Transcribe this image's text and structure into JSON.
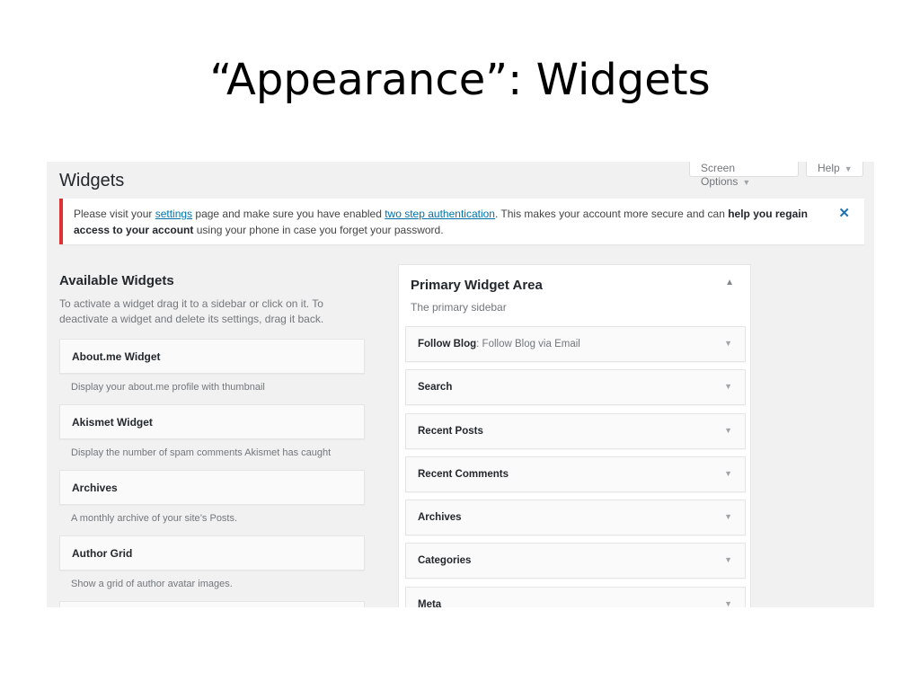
{
  "slide_title": "“Appearance”: Widgets",
  "header": {
    "page_title": "Widgets",
    "screen_options": "Screen Options",
    "help": "Help",
    "arrow": "▼"
  },
  "notice": {
    "t1": "Please visit your ",
    "link1": "settings",
    "t2": " page and make sure you have enabled ",
    "link2": "two step authentication",
    "t3": ". This makes your account more secure and can ",
    "bold1": "help you regain access to your account",
    "t4": " using your phone in case you forget your password.",
    "dismiss": "✕"
  },
  "available": {
    "title": "Available Widgets",
    "desc": "To activate a widget drag it to a sidebar or click on it. To deactivate a widget and delete its settings, drag it back.",
    "items": [
      {
        "name": "About.me Widget",
        "desc": "Display your about.me profile with thumbnail"
      },
      {
        "name": "Akismet Widget",
        "desc": "Display the number of spam comments Akismet has caught"
      },
      {
        "name": "Archives",
        "desc": "A monthly archive of your site’s Posts."
      },
      {
        "name": "Author Grid",
        "desc": "Show a grid of author avatar images."
      }
    ]
  },
  "primary": {
    "title": "Primary Widget Area",
    "toggle": "▲",
    "desc": "The primary sidebar",
    "items": [
      {
        "title": "Follow Blog",
        "subtitle": ": Follow Blog via Email"
      },
      {
        "title": "Search",
        "subtitle": ""
      },
      {
        "title": "Recent Posts",
        "subtitle": ""
      },
      {
        "title": "Recent Comments",
        "subtitle": ""
      },
      {
        "title": "Archives",
        "subtitle": ""
      },
      {
        "title": "Categories",
        "subtitle": ""
      },
      {
        "title": "Meta",
        "subtitle": ""
      }
    ]
  }
}
